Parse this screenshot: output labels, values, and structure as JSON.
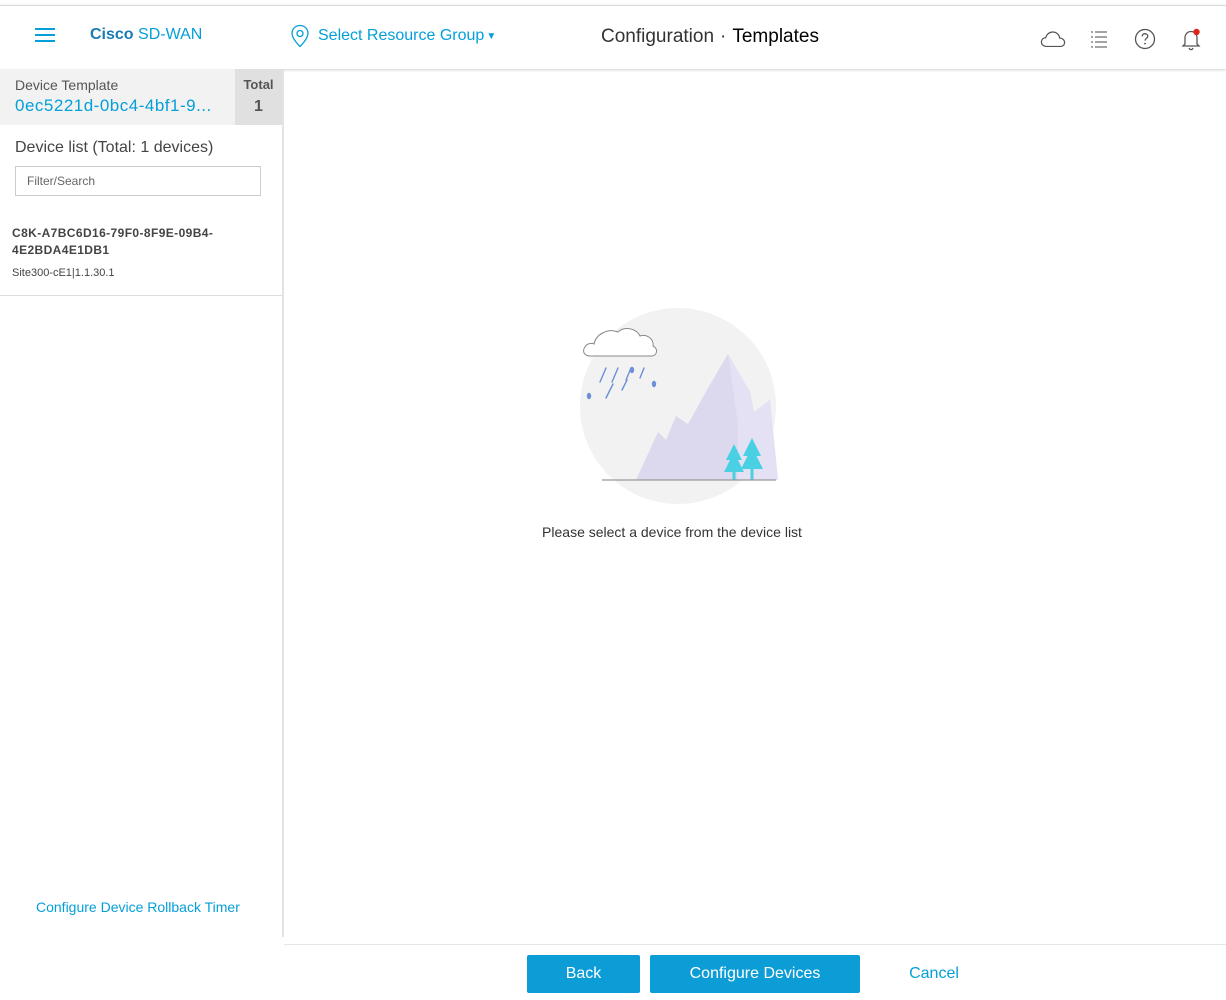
{
  "header": {
    "brand_bold": "Cisco",
    "brand_rest": " SD-WAN",
    "resource_group": "Select Resource Group",
    "breadcrumb_parent": "Configuration",
    "breadcrumb_separator": "·",
    "breadcrumb_current": "Templates",
    "icons": [
      "cloud-icon",
      "task-list-icon",
      "help-icon",
      "notification-bell-icon"
    ],
    "notification_dot_color": "#e2231a"
  },
  "sidebar": {
    "template_label": "Device Template",
    "template_value": "0ec5221d-0bc4-4bf1-9...",
    "total_label": "Total",
    "total_value": "1",
    "device_list_title": "Device list (Total: 1 devices)",
    "filter_placeholder": "Filter/Search",
    "devices": [
      {
        "name": "C8K-A7BC6D16-79F0-8F9E-09B4-4E2BDA4E1DB1",
        "detail": "Site300-cE1|1.1.30.1"
      }
    ],
    "rollback_link": "Configure Device Rollback Timer"
  },
  "main": {
    "empty_message": "Please select a device from the device list"
  },
  "footer": {
    "back_label": "Back",
    "configure_label": "Configure Devices",
    "cancel_label": "Cancel"
  },
  "colors": {
    "accent": "#049fd9",
    "button": "#0d9dd6"
  }
}
